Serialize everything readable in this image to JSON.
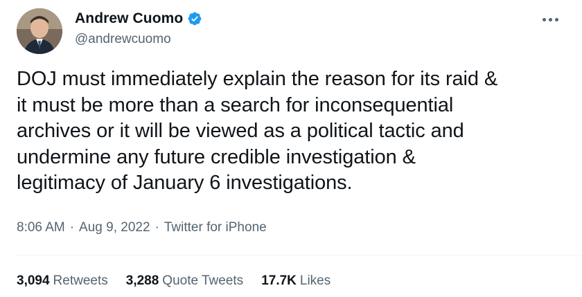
{
  "author": {
    "display_name": "Andrew Cuomo",
    "handle": "@andrewcuomo",
    "verified": true
  },
  "tweet": {
    "text": "DOJ must immediately explain the reason for its raid &\nit must be more than a search for inconsequential\narchives or it will be viewed as a political tactic and\nundermine any future credible investigation &\nlegitimacy of January 6 investigations."
  },
  "meta": {
    "time": "8:06 AM",
    "separator": "·",
    "date": "Aug 9, 2022",
    "source": "Twitter for iPhone"
  },
  "stats": {
    "retweets": {
      "count": "3,094",
      "label": "Retweets"
    },
    "quote_tweets": {
      "count": "3,288",
      "label": "Quote Tweets"
    },
    "likes": {
      "count": "17.7K",
      "label": "Likes"
    }
  },
  "colors": {
    "text_primary": "#0f1419",
    "text_secondary": "#536471",
    "verified_blue": "#1d9bf0"
  },
  "icons": {
    "more": "more-horizontal-icon",
    "verified": "verified-badge-icon"
  }
}
